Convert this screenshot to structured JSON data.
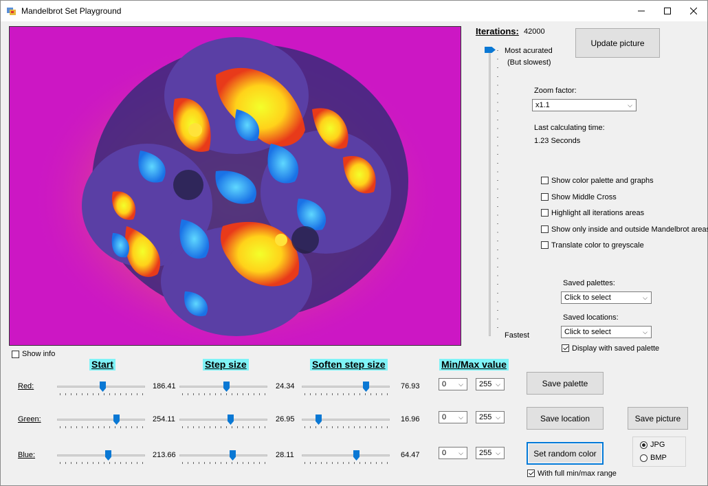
{
  "window": {
    "title": "Mandelbrot Set Playground"
  },
  "iterations": {
    "label": "Iterations:",
    "value": "42000",
    "top_label": "Most acurated",
    "top_sublabel": "(But slowest)",
    "bottom_label": "Fastest",
    "slider_fraction": 1.0
  },
  "buttons": {
    "update": "Update picture",
    "save_palette": "Save  palette",
    "save_location": "Save location",
    "save_picture": "Save picture",
    "random_color": "Set random color"
  },
  "zoom": {
    "label": "Zoom factor:",
    "value": "x1.1"
  },
  "calc": {
    "label": "Last calculating time:",
    "value": "1.23 Seconds"
  },
  "options": [
    {
      "label": "Show color palette and graphs",
      "checked": false
    },
    {
      "label": "Show Middle Cross",
      "checked": false
    },
    {
      "label": "Highlight all iterations areas",
      "checked": false
    },
    {
      "label": "Show only inside and outside Mandelbrot areas",
      "checked": false
    },
    {
      "label": "Translate color to greyscale",
      "checked": false
    }
  ],
  "saved_palettes": {
    "label": "Saved palettes:",
    "value": "Click to select"
  },
  "saved_locations": {
    "label": "Saved locations:",
    "value": "Click to select"
  },
  "display_saved_palette": {
    "label": "Display with saved palette",
    "checked": true
  },
  "show_info": {
    "label": "Show info",
    "checked": false
  },
  "headers": {
    "start": "Start",
    "step": "Step size",
    "soften": "Soften step size",
    "minmax": "Min/Max value"
  },
  "channels": [
    {
      "name": "Red:",
      "start": "186.41",
      "start_frac": 0.52,
      "step": "24.34",
      "step_frac": 0.54,
      "soften": "76.93",
      "soften_frac": 0.75,
      "min": "0",
      "max": "255"
    },
    {
      "name": "Green:",
      "start": "254.11",
      "start_frac": 0.69,
      "step": "26.95",
      "step_frac": 0.59,
      "soften": "16.96",
      "soften_frac": 0.17,
      "min": "0",
      "max": "255"
    },
    {
      "name": "Blue:",
      "start": "213.66",
      "start_frac": 0.59,
      "step": "28.11",
      "step_frac": 0.61,
      "soften": "64.47",
      "soften_frac": 0.63,
      "min": "0",
      "max": "255"
    }
  ],
  "full_range": {
    "label": "With full min/max range",
    "checked": true
  },
  "format": {
    "jpg": "JPG",
    "bmp": "BMP",
    "selected": "JPG"
  },
  "colors": {
    "canvas_bg": "#cc17c4",
    "header_bg": "#7ff3f7",
    "accent": "#0a78d4"
  }
}
